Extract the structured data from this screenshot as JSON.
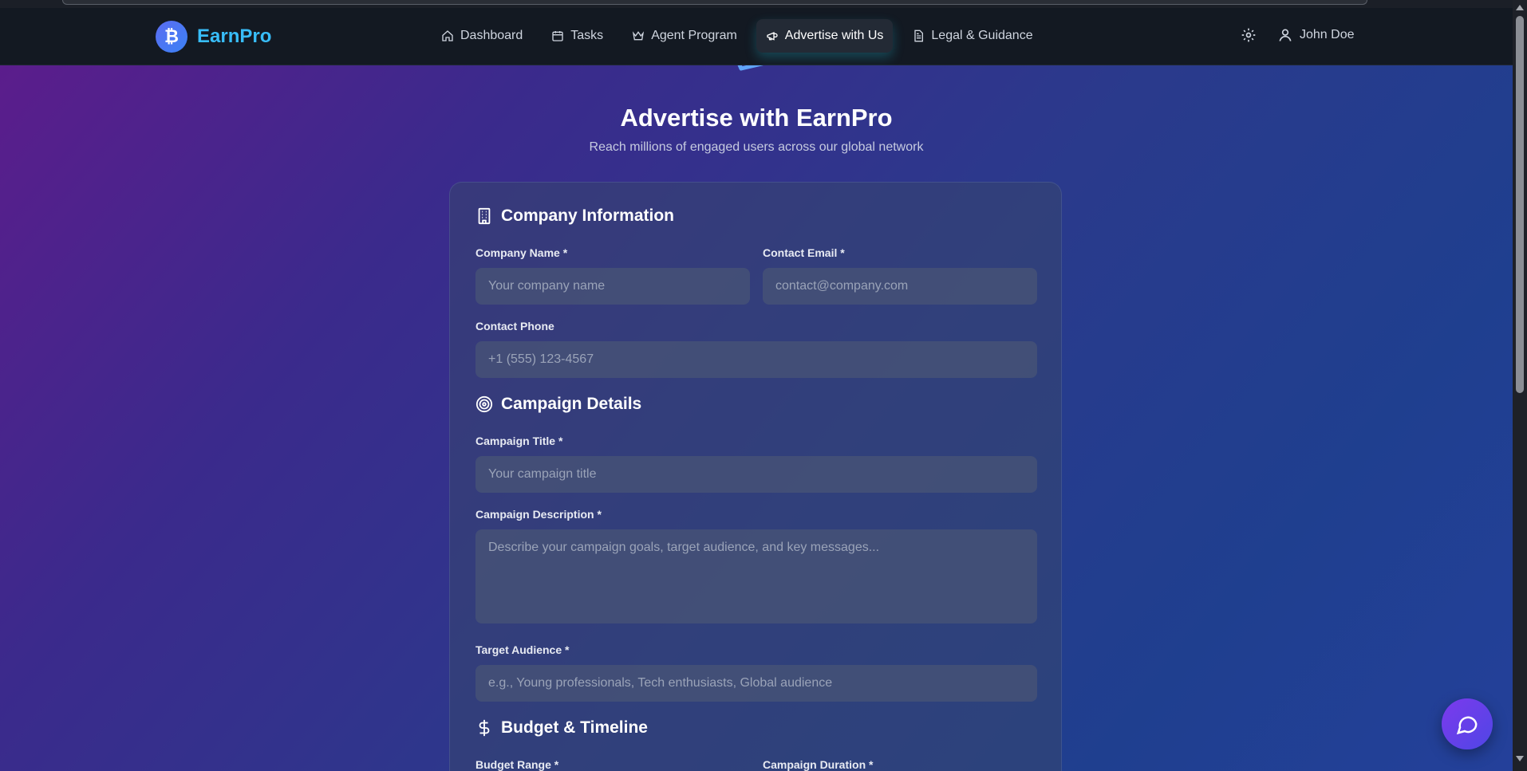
{
  "brand": {
    "logo_glyph": "₿",
    "name": "EarnPro"
  },
  "nav": {
    "items": [
      {
        "label": "Dashboard",
        "icon": "home-icon"
      },
      {
        "label": "Tasks",
        "icon": "calendar-icon"
      },
      {
        "label": "Agent Program",
        "icon": "crown-icon"
      },
      {
        "label": "Advertise with Us",
        "icon": "megaphone-icon",
        "active": true
      },
      {
        "label": "Legal & Guidance",
        "icon": "document-icon"
      }
    ],
    "settings_icon": "gear-icon",
    "user_name": "John Doe"
  },
  "hero": {
    "title": "Advertise with EarnPro",
    "subtitle": "Reach millions of engaged users across our global network"
  },
  "form": {
    "company": {
      "title": "Company Information",
      "company_name_label": "Company Name *",
      "company_name_placeholder": "Your company name",
      "contact_email_label": "Contact Email *",
      "contact_email_placeholder": "contact@company.com",
      "contact_phone_label": "Contact Phone",
      "contact_phone_placeholder": "+1 (555) 123-4567"
    },
    "campaign": {
      "title": "Campaign Details",
      "title_label": "Campaign Title *",
      "title_placeholder": "Your campaign title",
      "description_label": "Campaign Description *",
      "description_placeholder": "Describe your campaign goals, target audience, and key messages...",
      "audience_label": "Target Audience *",
      "audience_placeholder": "e.g., Young professionals, Tech enthusiasts, Global audience"
    },
    "budget": {
      "title": "Budget & Timeline",
      "budget_label": "Budget Range *",
      "duration_label": "Campaign Duration *"
    }
  },
  "colors": {
    "accent": "#38bdf8",
    "navbar_bg": "#131922",
    "chat_button": "#6d3bea"
  }
}
